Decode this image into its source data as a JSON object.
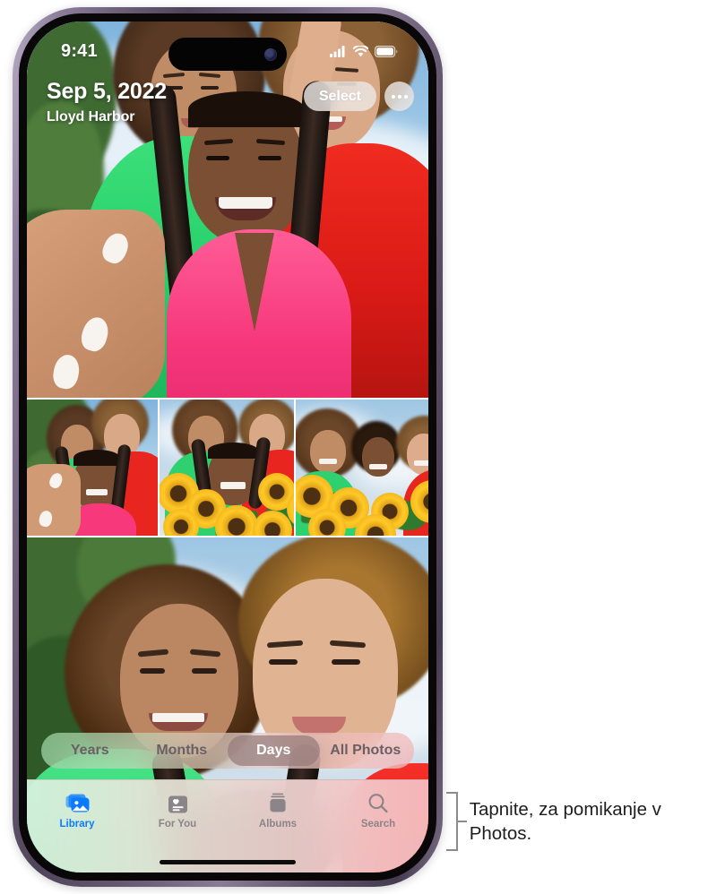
{
  "status_bar": {
    "time": "9:41",
    "icons": [
      "cellular-signal-icon",
      "wifi-icon",
      "battery-icon"
    ]
  },
  "header": {
    "date": "Sep 5, 2022",
    "location": "Lloyd Harbor",
    "select_label": "Select",
    "more_label": "more-options-icon"
  },
  "segmented_control": {
    "options": [
      {
        "label": "Years",
        "selected": false
      },
      {
        "label": "Months",
        "selected": false
      },
      {
        "label": "Days",
        "selected": true
      },
      {
        "label": "All Photos",
        "selected": false
      }
    ]
  },
  "tab_bar": {
    "tabs": [
      {
        "label": "Library",
        "icon": "photo-stack-icon",
        "active": true
      },
      {
        "label": "For You",
        "icon": "for-you-card-icon",
        "active": false
      },
      {
        "label": "Albums",
        "icon": "albums-stack-icon",
        "active": false
      },
      {
        "label": "Search",
        "icon": "search-magnifier-icon",
        "active": false
      }
    ]
  },
  "annotation": {
    "text": "Tapnite, za pomikanje v Photos."
  },
  "colors": {
    "accent_blue": "#0A7BFF",
    "inactive_gray": "#8B8488",
    "frame_purple": "#6D6078",
    "selected_pill": "#967C7A",
    "annotation_text": "#1D1D1F",
    "bracket_gray": "#8B8B8E"
  },
  "photo_grid": {
    "layout": "days-view",
    "rows": [
      {
        "count": 1,
        "photos": [
          {
            "subject": "three-friends-selfie-large"
          }
        ]
      },
      {
        "count": 3,
        "photos": [
          {
            "subject": "three-friends-park-selfie"
          },
          {
            "subject": "three-friends-sunflowers-center"
          },
          {
            "subject": "three-friends-sunflowers-right"
          }
        ]
      },
      {
        "count": 1,
        "photos": [
          {
            "subject": "two-friends-closeup-selfie"
          }
        ]
      }
    ]
  }
}
